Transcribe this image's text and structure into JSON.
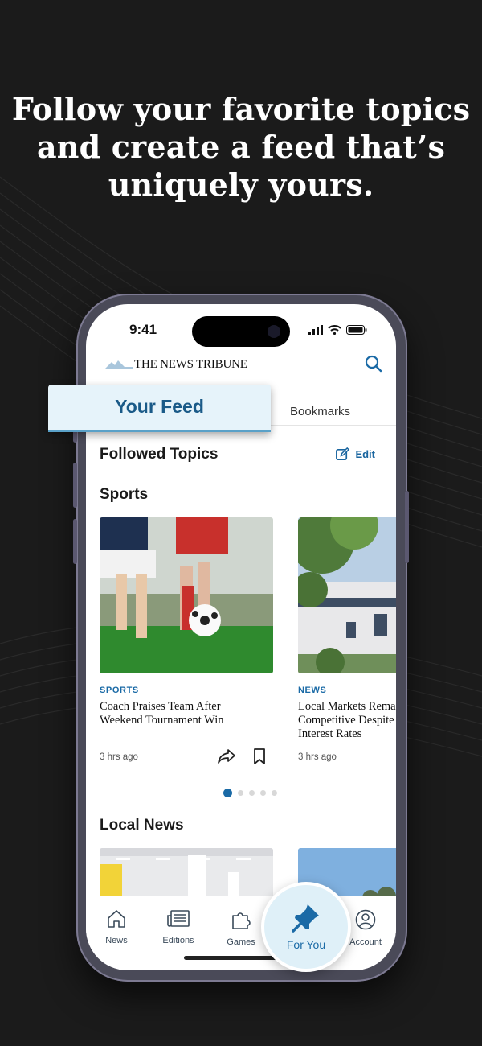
{
  "headline": {
    "line1": "Follow your favorite topics",
    "line2": "and create a feed that’s",
    "line3": "uniquely yours."
  },
  "status_bar": {
    "time": "9:41"
  },
  "app": {
    "masthead": "THE NEWS TRIBUNE",
    "tabs": {
      "your_feed": "Your Feed",
      "bookmarks": "Bookmarks"
    }
  },
  "feed": {
    "followed_topics_title": "Followed Topics",
    "edit_label": "Edit",
    "sports": {
      "title": "Sports",
      "cards": [
        {
          "kicker": "SPORTS",
          "headline_line1": "Coach Praises Team After",
          "headline_line2": "Weekend Tournament Win",
          "time": "3 hrs ago"
        },
        {
          "kicker": "NEWS",
          "headline_line1": "Local Markets Rema",
          "headline_line2": "Competitive Despite",
          "headline_line3": "Interest Rates",
          "time": "3 hrs ago"
        }
      ],
      "pagination": {
        "total": 5,
        "active": 1
      }
    },
    "local_news": {
      "title": "Local News"
    }
  },
  "bottom_nav": {
    "items": [
      {
        "label": "News",
        "icon": "home-icon"
      },
      {
        "label": "Editions",
        "icon": "newspaper-icon"
      },
      {
        "label": "Games",
        "icon": "puzzle-icon"
      },
      {
        "label": "For You",
        "icon": "pin-icon",
        "active": true
      },
      {
        "label": "Account",
        "icon": "account-icon"
      }
    ]
  },
  "colors": {
    "background": "#1b1b1b",
    "accent": "#1a6aa6",
    "feed_highlight": "#e6f3fa"
  }
}
